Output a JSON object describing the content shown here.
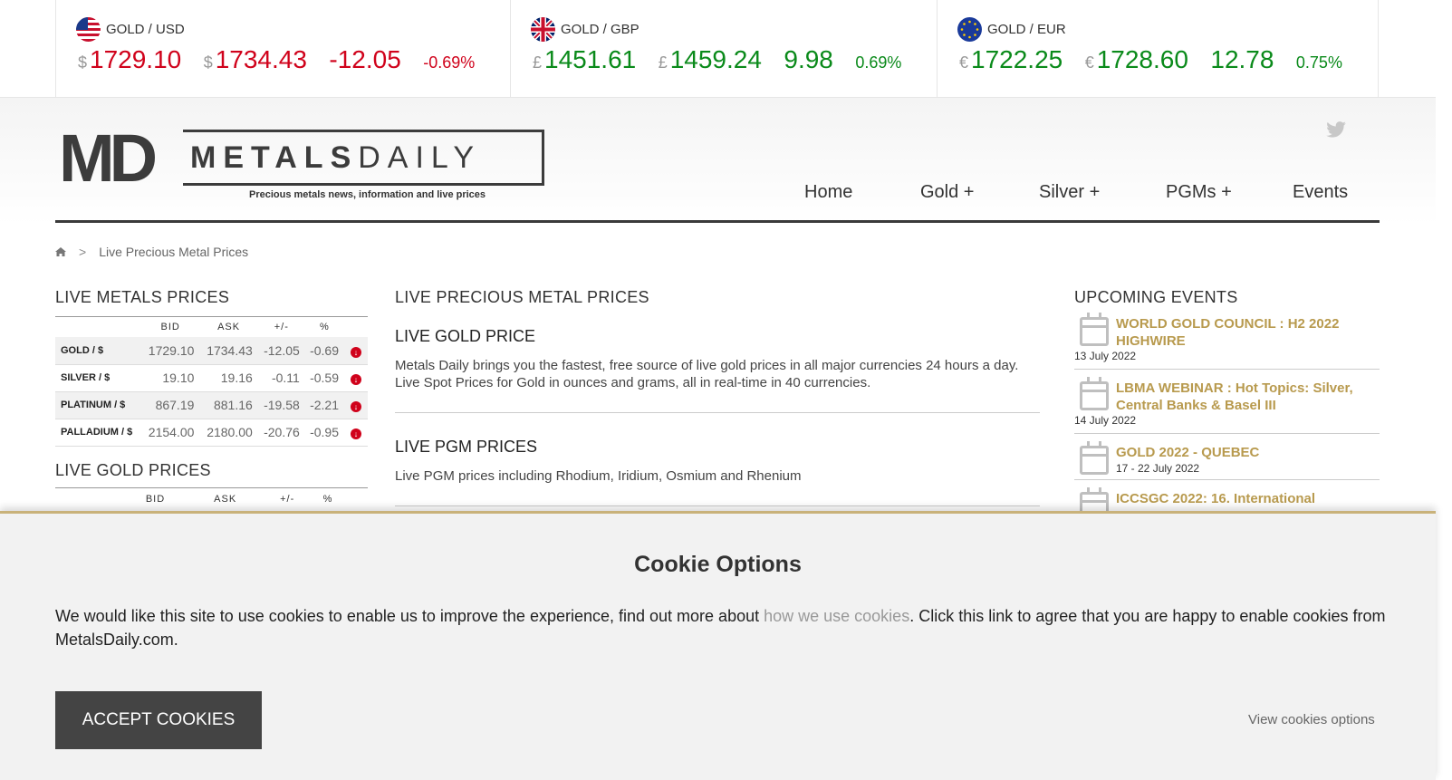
{
  "ticker": [
    {
      "pair": "GOLD / USD",
      "currency": "$",
      "bid": "1729.10",
      "ask": "1734.43",
      "change": "-12.05",
      "percent": "-0.69%",
      "direction": "down",
      "flag": "us-flag-icon"
    },
    {
      "pair": "GOLD / GBP",
      "currency": "£",
      "bid": "1451.61",
      "ask": "1459.24",
      "change": "9.98",
      "percent": "0.69%",
      "direction": "up",
      "flag": "uk-flag-icon"
    },
    {
      "pair": "GOLD / EUR",
      "currency": "€",
      "bid": "1722.25",
      "ask": "1728.60",
      "change": "12.78",
      "percent": "0.75%",
      "direction": "up",
      "flag": "eu-flag-icon"
    }
  ],
  "logo": {
    "letters": "MD",
    "word_bold": "METALS",
    "word_light": "DAILY",
    "tagline": "Precious metals news, information and live prices"
  },
  "nav": [
    "Home",
    "Gold +",
    "Silver +",
    "PGMs +",
    "Events"
  ],
  "breadcrumb": {
    "current": "Live Precious Metal Prices",
    "separator": ">"
  },
  "left": {
    "metals_title": "LIVE METALS PRICES",
    "columns": [
      "BID",
      "ASK",
      "+/-",
      "%"
    ],
    "rows": [
      {
        "name": "GOLD / $",
        "bid": "1729.10",
        "ask": "1734.43",
        "change": "-12.05",
        "percent": "-0.69"
      },
      {
        "name": "SILVER / $",
        "bid": "19.10",
        "ask": "19.16",
        "change": "-0.11",
        "percent": "-0.59"
      },
      {
        "name": "PLATINUM / $",
        "bid": "867.19",
        "ask": "881.16",
        "change": "-19.58",
        "percent": "-2.21"
      },
      {
        "name": "PALLADIUM / $",
        "bid": "2154.00",
        "ask": "2180.00",
        "change": "-20.76",
        "percent": "-0.95"
      }
    ],
    "gold_title": "LIVE GOLD PRICES",
    "gold_columns": [
      "BID",
      "ASK",
      "+/-",
      "%"
    ]
  },
  "main": {
    "title": "LIVE PRECIOUS METAL PRICES",
    "sections": [
      {
        "heading": "LIVE GOLD PRICE",
        "text": "Metals Daily brings you the fastest, free source of live gold prices in all major currencies 24 hours a day. Live Spot Prices for Gold in ounces and grams, all in real-time in 40 currencies."
      },
      {
        "heading": "LIVE PGM PRICES",
        "text": "Live PGM prices including Rhodium, Iridium, Osmium and Rhenium"
      }
    ]
  },
  "events": {
    "title": "UPCOMING EVENTS",
    "items": [
      {
        "title": "WORLD GOLD COUNCIL : H2 2022 HIGHWIRE",
        "date": "13 July 2022"
      },
      {
        "title": "LBMA WEBINAR : Hot Topics: Silver, Central Banks & Basel III",
        "date": "14 July 2022"
      },
      {
        "title": "GOLD 2022 - QUEBEC",
        "date": "17 - 22 July 2022"
      },
      {
        "title": "ICCSGC 2022: 16. International",
        "date": ""
      }
    ]
  },
  "cookie": {
    "title": "Cookie Options",
    "text_before": "We would like this site to use cookies to enable us to improve the experience, find out more about ",
    "link": "how we use cookies",
    "text_after": ". Click this link to agree that you are happy to enable cookies from MetalsDaily.com.",
    "accept": "ACCEPT COOKIES",
    "options": "View cookies options"
  },
  "colors": {
    "down": "#d0021b",
    "up": "#0a8a1a",
    "accent": "#b89a4e"
  }
}
